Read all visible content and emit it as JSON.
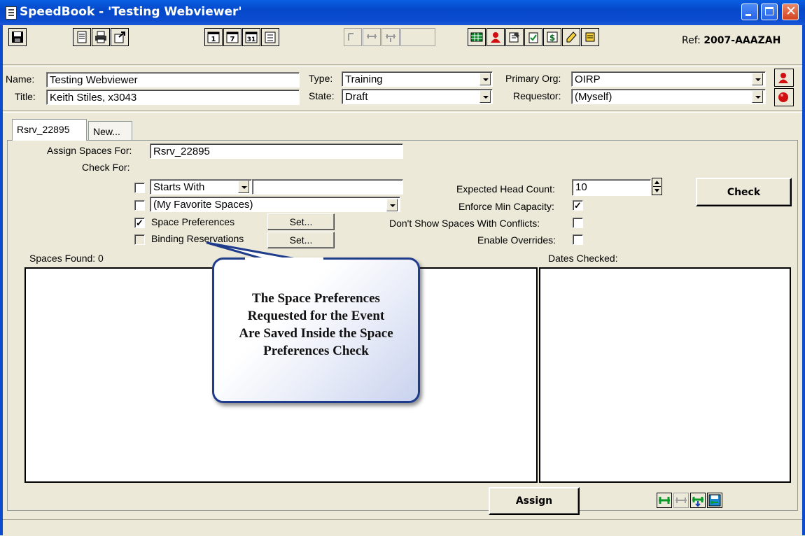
{
  "window": {
    "title": "SpeedBook - 'Testing Webviewer'",
    "controls": [
      "minimize",
      "maximize",
      "close"
    ]
  },
  "toolbar": {
    "ref_label": "Ref:",
    "ref_value": "2007-AAAZAH",
    "calendar_day": "1",
    "calendar_week": "7",
    "calendar_month": "31"
  },
  "header": {
    "name_label": "Name:",
    "name_value": "Testing Webviewer",
    "title_label": "Title:",
    "title_value": "Keith Stiles, x3043",
    "type_label": "Type:",
    "type_value": "Training",
    "state_label": "State:",
    "state_value": "Draft",
    "primary_org_label": "Primary Org:",
    "primary_org_value": "OIRP",
    "requestor_label": "Requestor:",
    "requestor_value": "(Myself)"
  },
  "tabs": [
    {
      "label": "Rsrv_22895",
      "active": true
    },
    {
      "label": "New...",
      "active": false
    }
  ],
  "assign": {
    "assign_for_label": "Assign Spaces For:",
    "assign_for_value": "Rsrv_22895",
    "check_for_label": "Check For:",
    "starts_with_option": "Starts With",
    "starts_with_text": "",
    "favorites_option": "(My Favorite Spaces)",
    "space_prefs_label": "Space Preferences",
    "space_prefs_checked": true,
    "binding_label": "Binding Reservations",
    "binding_checked": false,
    "set_label": "Set...",
    "head_count_label": "Expected Head Count:",
    "head_count_value": "10",
    "enforce_min_label": "Enforce Min Capacity:",
    "enforce_min_checked": true,
    "no_conflicts_label": "Don't Show Spaces With Conflicts:",
    "no_conflicts_checked": false,
    "overrides_label": "Enable Overrides:",
    "overrides_checked": false,
    "check_button": "Check",
    "spaces_found_label": "Spaces Found: 0",
    "dates_checked_label": "Dates Checked:",
    "assign_button": "Assign"
  },
  "callout": {
    "line1": "The Space Preferences",
    "line2": "Requested for the Event",
    "line3": "Are Saved Inside the Space",
    "line4": "Preferences Check"
  },
  "colors": {
    "titlebar": "#0548C9",
    "window_bg": "#ECE9D8",
    "callout_border": "#1F3C8C"
  }
}
